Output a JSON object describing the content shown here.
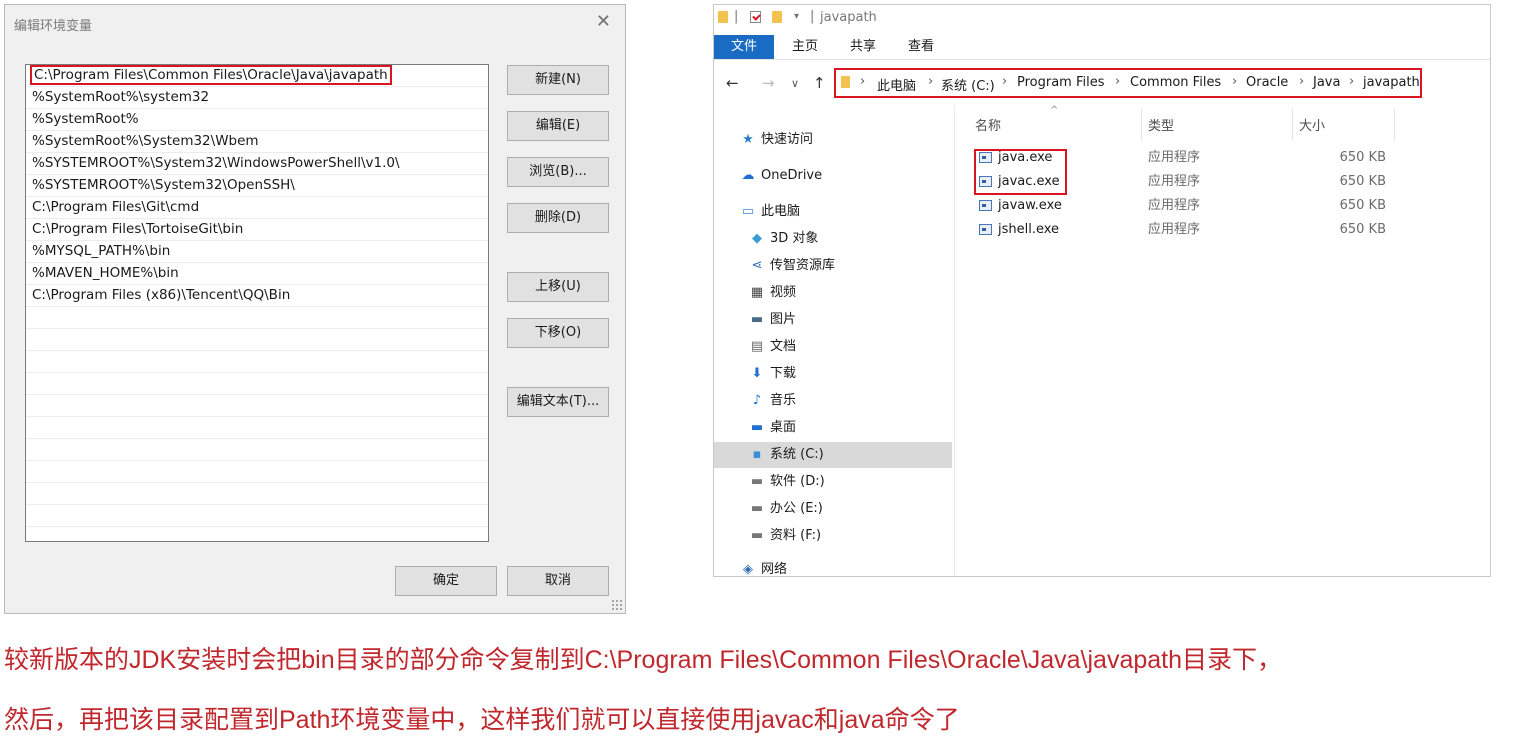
{
  "dialog": {
    "title": "编辑环境变量",
    "close_glyph": "✕",
    "entries": [
      "C:\\Program Files\\Common Files\\Oracle\\Java\\javapath",
      "%SystemRoot%\\system32",
      "%SystemRoot%",
      "%SystemRoot%\\System32\\Wbem",
      "%SYSTEMROOT%\\System32\\WindowsPowerShell\\v1.0\\",
      "%SYSTEMROOT%\\System32\\OpenSSH\\",
      "C:\\Program Files\\Git\\cmd",
      "C:\\Program Files\\TortoiseGit\\bin",
      "%MYSQL_PATH%\\bin",
      "%MAVEN_HOME%\\bin",
      "C:\\Program Files (x86)\\Tencent\\QQ\\Bin"
    ],
    "buttons": {
      "new": "新建(N)",
      "edit": "编辑(E)",
      "browse": "浏览(B)...",
      "delete": "删除(D)",
      "move_up": "上移(U)",
      "move_down": "下移(O)",
      "edit_text": "编辑文本(T)...",
      "ok": "确定",
      "cancel": "取消"
    }
  },
  "explorer": {
    "window_title": "javapath",
    "ribbon_tabs": [
      "文件",
      "主页",
      "共享",
      "查看"
    ],
    "breadcrumb": [
      "此电脑",
      "系统 (C:)",
      "Program Files",
      "Common Files",
      "Oracle",
      "Java",
      "javapath"
    ],
    "nav_items": [
      {
        "label": "快速访问",
        "icon": "star-icon"
      },
      {
        "label": "OneDrive",
        "icon": "cloud-icon"
      },
      {
        "label": "此电脑",
        "icon": "computer-icon"
      },
      {
        "label": "3D 对象",
        "icon": "cube-icon"
      },
      {
        "label": "传智资源库",
        "icon": "share-icon"
      },
      {
        "label": "视频",
        "icon": "video-icon"
      },
      {
        "label": "图片",
        "icon": "picture-icon"
      },
      {
        "label": "文档",
        "icon": "document-icon"
      },
      {
        "label": "下载",
        "icon": "download-icon"
      },
      {
        "label": "音乐",
        "icon": "music-icon"
      },
      {
        "label": "桌面",
        "icon": "desktop-icon"
      },
      {
        "label": "系统 (C:)",
        "icon": "drive-c-icon"
      },
      {
        "label": "软件 (D:)",
        "icon": "drive-icon"
      },
      {
        "label": "办公 (E:)",
        "icon": "drive-icon"
      },
      {
        "label": "资料 (F:)",
        "icon": "drive-icon"
      },
      {
        "label": "网络",
        "icon": "network-icon"
      }
    ],
    "columns": {
      "name": "名称",
      "type": "类型",
      "size": "大小"
    },
    "files": [
      {
        "name": "java.exe",
        "type": "应用程序",
        "size": "650 KB"
      },
      {
        "name": "javac.exe",
        "type": "应用程序",
        "size": "650 KB"
      },
      {
        "name": "javaw.exe",
        "type": "应用程序",
        "size": "650 KB"
      },
      {
        "name": "jshell.exe",
        "type": "应用程序",
        "size": "650 KB"
      }
    ],
    "selected_nav": "系统 (C:)"
  },
  "caption": {
    "line1": "较新版本的JDK安装时会把bin目录的部分命令复制到C:\\Program Files\\Common Files\\Oracle\\Java\\javapath目录下，",
    "line2": "然后，再把该目录配置到Path环境变量中，这样我们就可以直接使用javac和java命令了"
  },
  "colors": {
    "highlight": "#d9161f",
    "caption": "#c0282d",
    "ribbon_active": "#1a6bc4"
  }
}
